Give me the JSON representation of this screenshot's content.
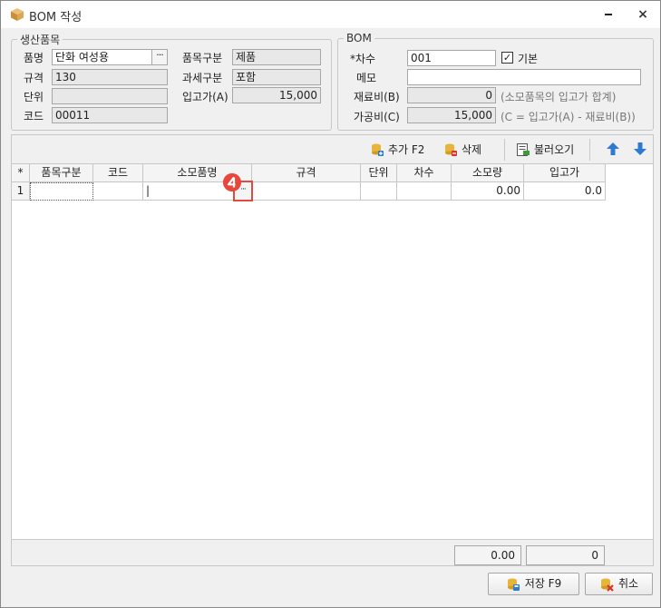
{
  "window": {
    "title": "BOM 작성",
    "minimize_label": "",
    "close_label": "×"
  },
  "product_group": {
    "legend": "생산품목",
    "name_label": "품명",
    "name_value": "단화 여성용",
    "lookup_label": "···",
    "spec_label": "규격",
    "spec_value": "130",
    "unit_label": "단위",
    "unit_value": "",
    "code_label": "코드",
    "code_value": "00011",
    "category_label": "품목구분",
    "category_value": "제품",
    "tax_label": "과세구분",
    "tax_value": "포함",
    "inprice_label": "입고가(A)",
    "inprice_value": "15,000"
  },
  "bom_group": {
    "legend": "BOM",
    "revision_label": "*차수",
    "revision_value": "001",
    "default_checked": true,
    "default_label": "기본",
    "memo_label": "메모",
    "memo_value": "",
    "material_label": "재료비(B)",
    "material_value": "0",
    "material_note": "(소모품목의 입고가 합계)",
    "process_label": "가공비(C)",
    "process_value": "15,000",
    "process_note": "(C = 입고가(A) - 재료비(B))"
  },
  "toolbar": {
    "add_label": "추가 F2",
    "delete_label": "삭제",
    "load_label": "불러오기"
  },
  "grid": {
    "corner": "*",
    "headers": [
      "품목구분",
      "코드",
      "소모품명",
      "규격",
      "단위",
      "차수",
      "소모량",
      "입고가"
    ],
    "rows": [
      {
        "index": "1",
        "cells": [
          "",
          "",
          "|",
          "",
          "",
          "",
          "0.00",
          "0.0"
        ]
      }
    ]
  },
  "totals": {
    "quantity": "0.00",
    "price": "0"
  },
  "buttons": {
    "save_label": "저장 F9",
    "cancel_label": "취소"
  },
  "colors": {
    "accent_red": "#e8483c",
    "arrow_blue": "#2e7ad1"
  }
}
